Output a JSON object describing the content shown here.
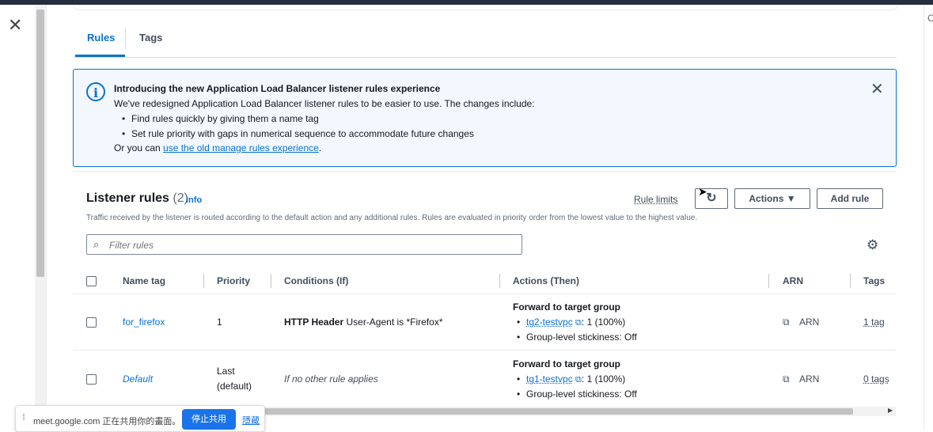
{
  "window": {
    "close_icon": "close-icon",
    "right_edge_glyph": "C"
  },
  "tabs": [
    {
      "label": "Rules",
      "selected": true
    },
    {
      "label": "Tags",
      "selected": false
    }
  ],
  "info_alert": {
    "title": "Introducing the new Application Load Balancer listener rules experience",
    "line1": "We've redesigned Application Load Balancer listener rules to be easier to use. The changes include:",
    "bullets": [
      "Find rules quickly by giving them a name tag",
      "Set rule priority with gaps in numerical sequence to accommodate future changes"
    ],
    "footer_prefix": "Or you can ",
    "footer_link": "use the old manage rules experience",
    "footer_suffix": "."
  },
  "listener_rules": {
    "title": "Listener rules",
    "count": "(2)",
    "info_link": "Info",
    "description": "Traffic received by the listener is routed according to the default action and any additional rules. Rules are evaluated in priority order from the lowest value to the highest value.",
    "rule_limits": "Rule limits",
    "refresh_icon": "↻",
    "actions_label": "Actions ▼",
    "add_rule_label": "Add rule",
    "filter_placeholder": "Filter rules",
    "columns": [
      "Name tag",
      "Priority",
      "Conditions (If)",
      "Actions (Then)",
      "ARN",
      "Tags"
    ],
    "rows": [
      {
        "name_tag": "for_firefox",
        "priority_line1": "1",
        "priority_line2": "",
        "condition_bold": "HTTP Header",
        "condition_text": " User-Agent is *Firefox*",
        "action_title": "Forward to target group",
        "target_group": "tg2-testvpc",
        "target_weight": ": 1 (100%)",
        "stickiness": "Group-level stickiness: Off",
        "arn": "ARN",
        "tags": "1 tag"
      },
      {
        "name_tag": "Default",
        "priority_line1": "Last",
        "priority_line2": "(default)",
        "condition_text": "If no other rule applies",
        "action_title": "Forward to target group",
        "target_group": "tg1-testvpc",
        "target_weight": ": 1 (100%)",
        "stickiness": "Group-level stickiness: Off",
        "arn": "ARN",
        "tags": "0 tags"
      }
    ]
  },
  "screen_share_bar": {
    "message": "meet.google.com 正在共用你的畫面。",
    "stop_label": "停止共用",
    "hide_label": "隱藏"
  }
}
